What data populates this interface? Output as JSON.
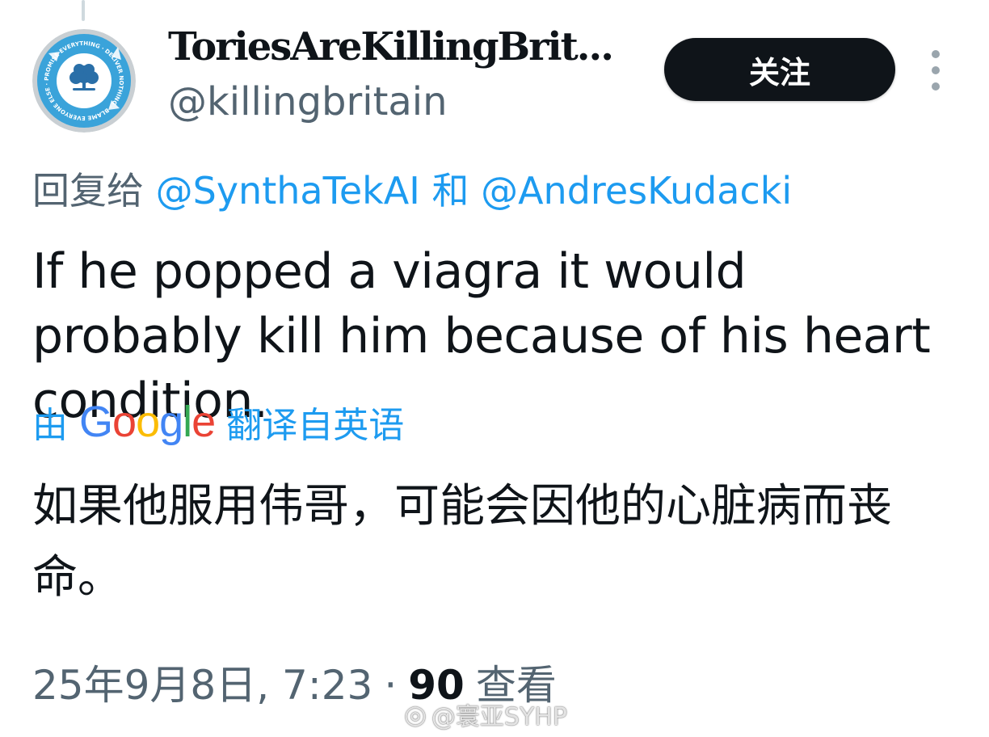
{
  "author": {
    "display_name": "ToriesAreKillingBrit...",
    "handle": "@killingbritain",
    "avatar_text": "PROMISE EVERYTHING · DELIVER NOTHING · BLAME EVERYONE ELSE · GIVE TO MATES"
  },
  "follow_label": "关注",
  "reply": {
    "prefix": "回复给",
    "mention_1": "@SynthaTekAI",
    "conjunction": "和",
    "mention_2": "@AndresKudacki"
  },
  "tweet_text": "If he popped a viagra it would probably kill him because of his heart condition.",
  "translation": {
    "prefix": "由",
    "google_letters": [
      "G",
      "o",
      "o",
      "g",
      "l",
      "e"
    ],
    "suffix": "翻译自英语",
    "text": "如果他服用伟哥，可能会因他的心脏病而丧命。"
  },
  "meta": {
    "timestamp": "25年9月8日, 7:23",
    "separator": "·",
    "views_count": "90",
    "views_label": "查看"
  },
  "watermark": {
    "text": "@寰亚SYHP"
  },
  "colors": {
    "accent": "#1d9bf0",
    "text": "#0f1419",
    "muted": "#536471",
    "button_bg": "#0f1419",
    "avatar_ring": "#3aa3da"
  },
  "icons": {
    "more": "more-vertical-icon",
    "avatar_tree": "tree-logo-icon",
    "watermark": "weibo-icon"
  }
}
